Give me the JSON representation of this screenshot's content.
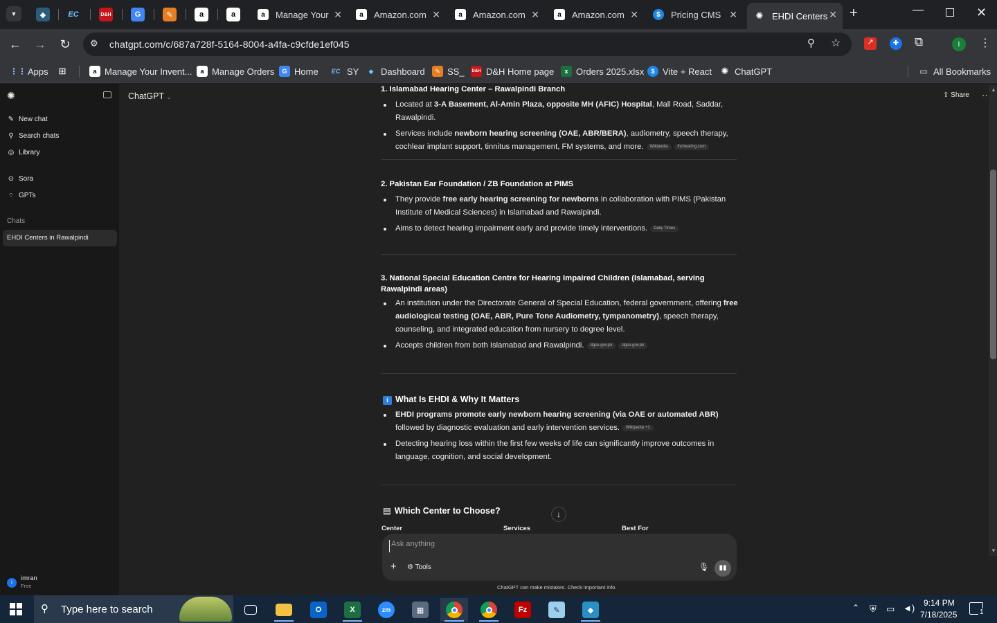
{
  "browser": {
    "tabs": [
      {
        "label": "Manage Your",
        "icon": "amazon-icon"
      },
      {
        "label": "Amazon.com",
        "icon": "amazon-icon"
      },
      {
        "label": "Amazon.com",
        "icon": "amazon-icon"
      },
      {
        "label": "Amazon.com",
        "icon": "amazon-icon"
      },
      {
        "label": "Pricing CMS",
        "icon": "dollar-icon"
      },
      {
        "label": "EHDI Centers",
        "icon": "chatgpt-icon",
        "active": true
      }
    ],
    "pinned_icons": [
      "app-icon",
      "ec-icon",
      "dh-icon",
      "gmail-icon",
      "sketch-icon",
      "amazon-icon",
      "amazon-icon"
    ],
    "url": "chatgpt.com/c/687a728f-5164-8004-a4fa-c9cfde1ef045",
    "bookmarks": [
      "Apps",
      "Manage Your Invent...",
      "Manage Orders",
      "Home",
      "SY",
      "Dashboard",
      "SS_",
      "D&H Home page",
      "Orders 2025.xlsx",
      "Vite + React",
      "ChatGPT"
    ],
    "all_bookmarks": "All Bookmarks",
    "profile_initial": "i"
  },
  "sidebar": {
    "items": [
      {
        "label": "New chat",
        "icon": "compose-icon"
      },
      {
        "label": "Search chats",
        "icon": "search-icon"
      },
      {
        "label": "Library",
        "icon": "library-icon"
      },
      {
        "label": "Sora",
        "icon": "sora-icon"
      },
      {
        "label": "GPTs",
        "icon": "grid-icon"
      }
    ],
    "chats_heading": "Chats",
    "chats": [
      "EHDI Centers in Rawalpindi"
    ],
    "user": {
      "name": "imran",
      "plan": "Free",
      "initial": "i"
    }
  },
  "header": {
    "model": "ChatGPT",
    "share": "Share"
  },
  "sections": [
    {
      "title": "1. Islamabad Hearing Center – Rawalpindi Branch",
      "bullets": [
        {
          "pre": "Located at ",
          "bold": "3-A Basement, Al-Amin Plaza, opposite MH (AFIC) Hospital",
          "post": ", Mall Road, Saddar, Rawalpindi.",
          "cites": []
        },
        {
          "pre": "Services include ",
          "bold": "newborn hearing screening (OAE, ABR/BERA)",
          "post": ", audiometry, speech therapy, cochlear implant support, tinnitus management, FM systems, and more.",
          "cites": [
            "Wikipedia",
            "ihchearing.com"
          ]
        }
      ]
    },
    {
      "title": "2. Pakistan Ear Foundation / ZB Foundation at PIMS",
      "bullets": [
        {
          "pre": "They provide ",
          "bold": "free early hearing screening for newborns",
          "post": " in collaboration with PIMS (Pakistan Institute of Medical Sciences) in Islamabad and Rawalpindi.",
          "cites": []
        },
        {
          "pre": "Aims to detect hearing impairment early and provide timely interventions.",
          "bold": "",
          "post": "",
          "cites": [
            "Daily Times"
          ]
        }
      ]
    },
    {
      "title": "3. National Special Education Centre for Hearing Impaired Children (Islamabad, serving Rawalpindi areas)",
      "bullets": [
        {
          "pre": "An institution under the Directorate General of Special Education, federal government, offering ",
          "bold": "free audiological testing (OAE, ABR, Pure Tone Audiometry, tympanometry)",
          "post": ", speech therapy, counseling, and integrated education from nursery to degree level.",
          "cites": []
        },
        {
          "pre": "Accepts children from both Islamabad and Rawalpindi.",
          "bold": "",
          "post": "",
          "cites": [
            "dgse.gov.pk",
            "dgse.gov.pk"
          ]
        }
      ]
    },
    {
      "title": "What Is EHDI & Why It Matters",
      "emoji": "i",
      "bullets": [
        {
          "pre": "",
          "bold": "EHDI programs promote early newborn hearing screening (via OAE or automated ABR)",
          "post": " followed by diagnostic evaluation and early intervention services.",
          "cites": [
            "Wikipedia +1"
          ]
        },
        {
          "pre": "Detecting hearing loss within the first few weeks of life can significantly improve outcomes in language, cognition, and social development.",
          "bold": "",
          "post": "",
          "cites": []
        }
      ]
    },
    {
      "title": "Which Center to Choose?",
      "emoji": "clipboard",
      "table_headers": [
        "Center",
        "Services",
        "Best For"
      ]
    }
  ],
  "composer": {
    "placeholder": "Ask anything",
    "tools": "Tools"
  },
  "disclaimer": "ChatGPT can make mistakes. Check important info.",
  "taskbar": {
    "search_placeholder": "Type here to search",
    "time": "9:14 PM",
    "date": "7/18/2025",
    "notification_count": "1"
  }
}
